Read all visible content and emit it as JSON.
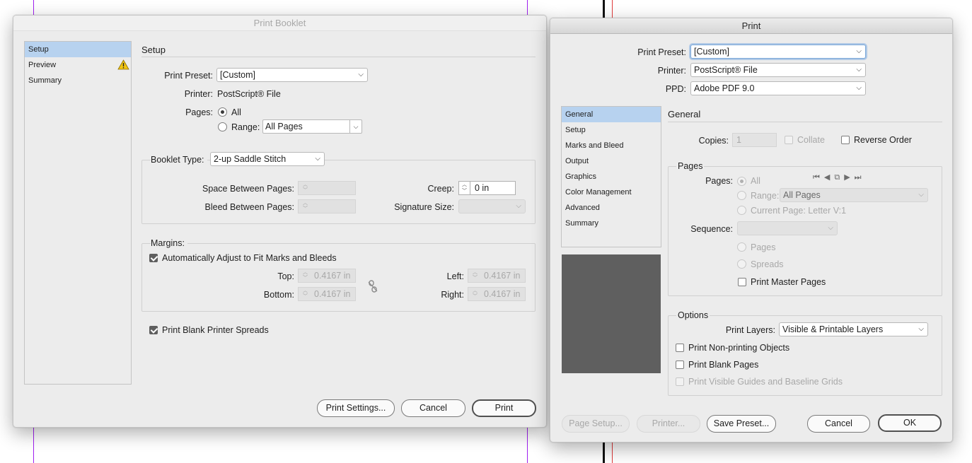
{
  "booklet": {
    "title": "Print Booklet",
    "sidebar": [
      {
        "label": "Setup",
        "selected": true
      },
      {
        "label": "Preview",
        "selected": false,
        "warning": true
      },
      {
        "label": "Summary",
        "selected": false
      }
    ],
    "section_title": "Setup",
    "print_preset_label": "Print Preset:",
    "print_preset_value": "[Custom]",
    "printer_label": "Printer:",
    "printer_value": "PostScript® File",
    "pages_label": "Pages:",
    "all_label": "All",
    "range_label": "Range:",
    "range_value": "All Pages",
    "booklet_type_label": "Booklet Type:",
    "booklet_type_value": "2-up Saddle Stitch",
    "space_between_label": "Space Between Pages:",
    "bleed_between_label": "Bleed Between Pages:",
    "creep_label": "Creep:",
    "creep_value": "0 in",
    "signature_label": "Signature Size:",
    "margins_title": "Margins:",
    "auto_adjust_label": "Automatically Adjust to Fit Marks and Bleeds",
    "top_label": "Top:",
    "top_value": "0.4167 in",
    "bottom_label": "Bottom:",
    "bottom_value": "0.4167 in",
    "left_label": "Left:",
    "left_value": "0.4167 in",
    "right_label": "Right:",
    "right_value": "0.4167 in",
    "blank_spreads_label": "Print Blank Printer Spreads",
    "buttons": {
      "print_settings": "Print Settings...",
      "cancel": "Cancel",
      "print": "Print"
    }
  },
  "print": {
    "title": "Print",
    "preset_label": "Print Preset:",
    "preset_value": "[Custom]",
    "printer_label": "Printer:",
    "printer_value": "PostScript® File",
    "ppd_label": "PPD:",
    "ppd_value": "Adobe PDF 9.0",
    "sidebar": [
      {
        "label": "General",
        "selected": true
      },
      {
        "label": "Setup",
        "selected": false
      },
      {
        "label": "Marks and Bleed",
        "selected": false
      },
      {
        "label": "Output",
        "selected": false
      },
      {
        "label": "Graphics",
        "selected": false
      },
      {
        "label": "Color Management",
        "selected": false
      },
      {
        "label": "Advanced",
        "selected": false
      },
      {
        "label": "Summary",
        "selected": false
      }
    ],
    "section_title": "General",
    "copies_label": "Copies:",
    "copies_value": "1",
    "collate_label": "Collate",
    "reverse_label": "Reverse Order",
    "pages_group": "Pages",
    "pages_label": "Pages:",
    "all_label": "All",
    "range_label": "Range:",
    "range_value": "All Pages",
    "current_page_label": "Current Page: Letter V:1",
    "sequence_label": "Sequence:",
    "pages_option": "Pages",
    "spreads_option": "Spreads",
    "master_pages_label": "Print Master Pages",
    "options_group": "Options",
    "layers_label": "Print Layers:",
    "layers_value": "Visible & Printable Layers",
    "nonprinting_label": "Print Non-printing Objects",
    "blank_pages_label": "Print Blank Pages",
    "guides_label": "Print Visible Guides and Baseline Grids",
    "buttons": {
      "page_setup": "Page Setup...",
      "printer": "Printer...",
      "save_preset": "Save Preset...",
      "cancel": "Cancel",
      "ok": "OK"
    }
  },
  "colors": {
    "selection": "#b7d2ef",
    "warning": "#f2c511",
    "guide": "#a020f0"
  }
}
